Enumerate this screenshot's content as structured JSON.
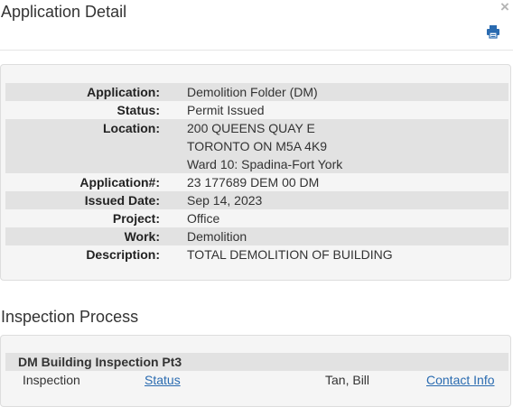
{
  "modal": {
    "title": "Application Detail"
  },
  "icons": {
    "close": "close-icon",
    "print": "printer-icon"
  },
  "details": [
    {
      "label": "Application:",
      "values": [
        "Demolition Folder (DM)"
      ]
    },
    {
      "label": "Status:",
      "values": [
        "Permit Issued"
      ]
    },
    {
      "label": "Location:",
      "values": [
        "200 QUEENS QUAY E",
        "TORONTO ON M5A 4K9",
        "Ward 10: Spadina-Fort York"
      ]
    },
    {
      "label": "Application#:",
      "values": [
        "23 177689 DEM 00 DM"
      ]
    },
    {
      "label": "Issued Date:",
      "values": [
        "Sep 14, 2023"
      ]
    },
    {
      "label": "Project:",
      "values": [
        "Office"
      ]
    },
    {
      "label": "Work:",
      "values": [
        "Demolition"
      ]
    },
    {
      "label": "Description:",
      "values": [
        "TOTAL DEMOLITION OF BUILDING"
      ]
    }
  ],
  "inspection": {
    "section_title": "Inspection Process",
    "group_title": "DM Building Inspection Pt3",
    "row": {
      "type": "Inspection",
      "status_link": "Status",
      "inspector": "Tan, Bill",
      "contact_link": "Contact Info"
    }
  },
  "colors": {
    "link": "#2a6bb0",
    "row_shade": "#e2e2e2",
    "panel_bg": "#f5f5f5"
  }
}
